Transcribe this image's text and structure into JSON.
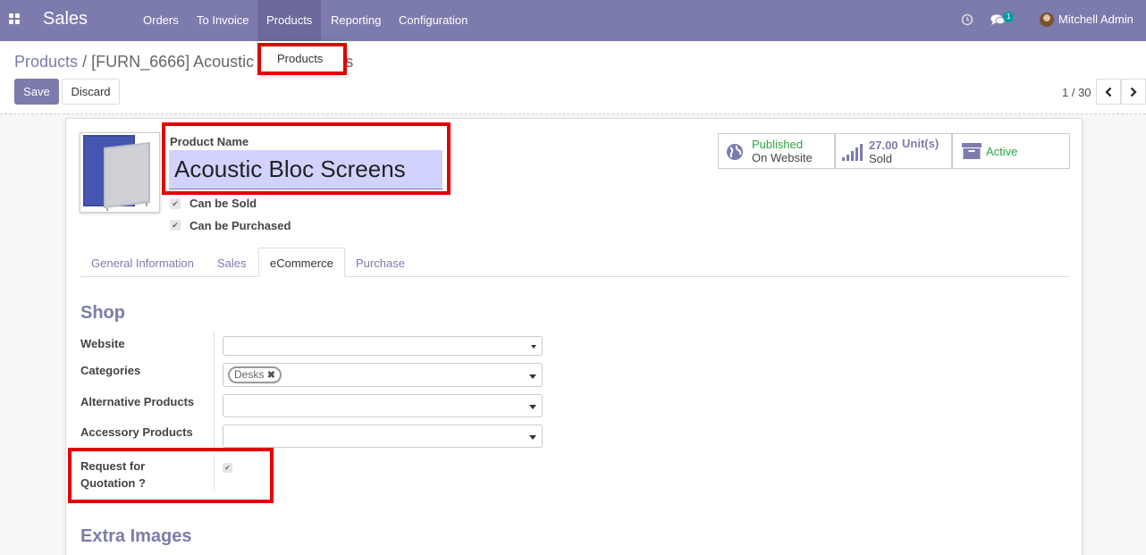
{
  "navbar": {
    "app_title": "Sales",
    "menu": [
      "Orders",
      "To Invoice",
      "Products",
      "Reporting",
      "Configuration"
    ],
    "message_count": "1",
    "user_name": "Mitchell Admin"
  },
  "dropdown": {
    "item": "Products"
  },
  "breadcrumb": {
    "parent": "Products",
    "separator": "/",
    "current": "[FURN_6666] Acoustic Bloc Screens"
  },
  "buttons": {
    "save": "Save",
    "discard": "Discard"
  },
  "pager": {
    "value": "1 / 30"
  },
  "form": {
    "product_name_label": "Product Name",
    "product_name": "Acoustic Bloc Screens",
    "can_be_sold": "Can be Sold",
    "can_be_purchased": "Can be Purchased"
  },
  "stats": {
    "published": "Published",
    "on_website": "On Website",
    "units_value": "27.00",
    "units_label": "Unit(s)",
    "sold": "Sold",
    "active": "Active"
  },
  "tabs": [
    "General Information",
    "Sales",
    "eCommerce",
    "Purchase"
  ],
  "shop": {
    "title": "Shop",
    "website_label": "Website",
    "categories_label": "Categories",
    "category_tag": "Desks",
    "alternative_label": "Alternative Products",
    "accessory_label": "Accessory Products",
    "rfq_label_line1": "Request for",
    "rfq_label_line2": "Quotation ?"
  },
  "extra_images": {
    "title": "Extra Images"
  },
  "colors": {
    "brand": "#7c7bad",
    "highlight": "#e30000",
    "published": "#28a745",
    "badge": "#00a09d"
  }
}
